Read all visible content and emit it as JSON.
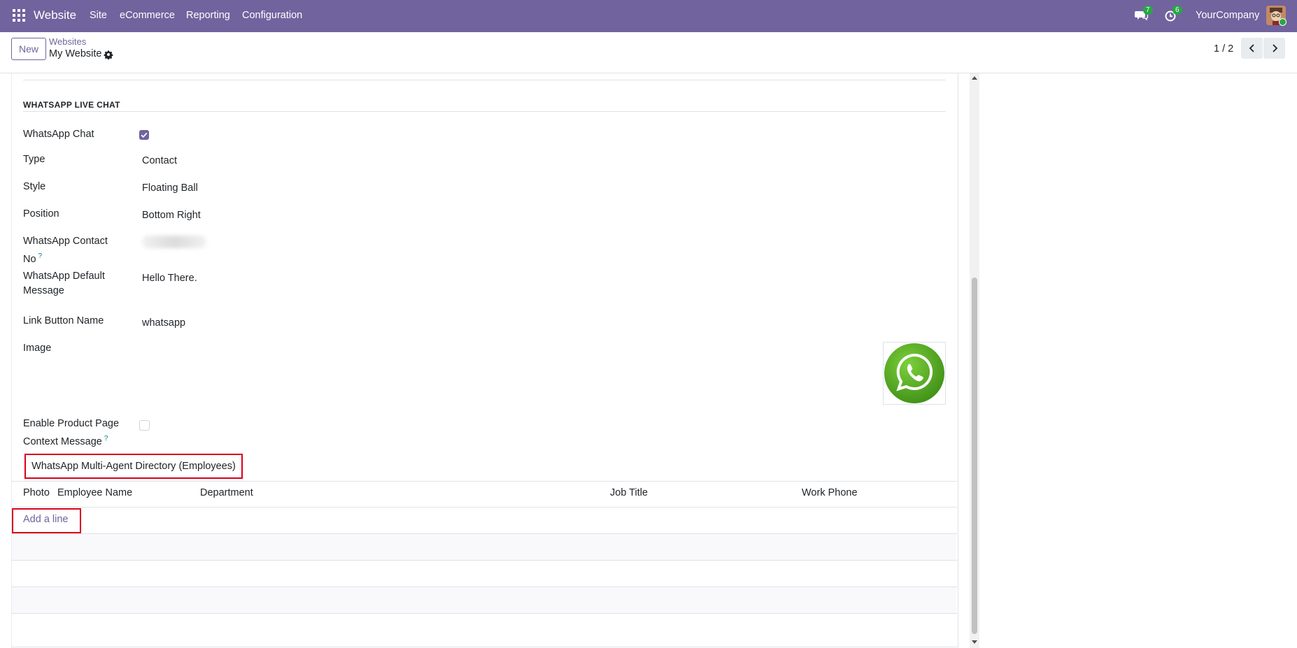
{
  "navbar": {
    "app_name": "Website",
    "menu": [
      "Site",
      "eCommerce",
      "Reporting",
      "Configuration"
    ],
    "messages_count": "7",
    "activities_count": "6",
    "company": "YourCompany",
    "bg_color": "#71639e"
  },
  "control_panel": {
    "new_label": "New",
    "breadcrumb_parent": "Websites",
    "breadcrumb_current": "My Website",
    "pager": "1 / 2"
  },
  "section": {
    "title": "WHATSAPP LIVE CHAT"
  },
  "fields": {
    "whatsapp_chat_label": "WhatsApp Chat",
    "whatsapp_chat_checked": true,
    "type_label": "Type",
    "type_value": "Contact",
    "style_label": "Style",
    "style_value": "Floating Ball",
    "position_label": "Position",
    "position_value": "Bottom Right",
    "contact_label_1": "WhatsApp Contact",
    "contact_label_2": "No",
    "default_msg_label_1": "WhatsApp Default",
    "default_msg_label_2": "Message",
    "default_msg_value": "Hello There.",
    "link_button_label": "Link Button Name",
    "link_button_value": "whatsapp",
    "image_label": "Image",
    "product_ctx_label_1": "Enable Product Page",
    "product_ctx_label_2": "Context Message",
    "product_ctx_checked": false,
    "help_mark": "?"
  },
  "tab": {
    "label": "WhatsApp Multi-Agent Directory (Employees)"
  },
  "table": {
    "columns": [
      "Photo",
      "Employee Name",
      "Department",
      "Job Title",
      "Work Phone"
    ],
    "add_line": "Add a line"
  },
  "colors": {
    "accent": "#71639e",
    "highlight_border": "#d9001b",
    "whatsapp_green": "#4caf23"
  }
}
